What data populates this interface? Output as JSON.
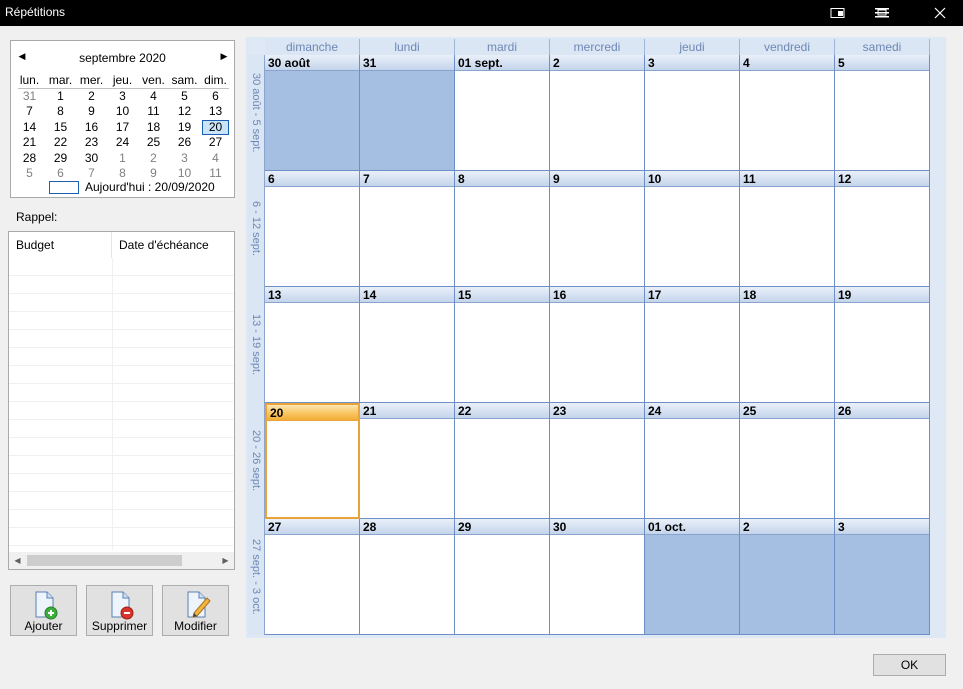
{
  "window": {
    "title": "Répétitions"
  },
  "minical": {
    "month_title": "septembre 2020",
    "weekdays": [
      "lun.",
      "mar.",
      "mer.",
      "jeu.",
      "ven.",
      "sam.",
      "dim."
    ],
    "days": [
      {
        "d": "31",
        "other": true
      },
      {
        "d": "1"
      },
      {
        "d": "2"
      },
      {
        "d": "3"
      },
      {
        "d": "4"
      },
      {
        "d": "5"
      },
      {
        "d": "6"
      },
      {
        "d": "7"
      },
      {
        "d": "8"
      },
      {
        "d": "9"
      },
      {
        "d": "10"
      },
      {
        "d": "11"
      },
      {
        "d": "12"
      },
      {
        "d": "13"
      },
      {
        "d": "14"
      },
      {
        "d": "15"
      },
      {
        "d": "16"
      },
      {
        "d": "17"
      },
      {
        "d": "18"
      },
      {
        "d": "19"
      },
      {
        "d": "20",
        "today": true
      },
      {
        "d": "21"
      },
      {
        "d": "22"
      },
      {
        "d": "23"
      },
      {
        "d": "24"
      },
      {
        "d": "25"
      },
      {
        "d": "26"
      },
      {
        "d": "27"
      },
      {
        "d": "28"
      },
      {
        "d": "29"
      },
      {
        "d": "30"
      },
      {
        "d": "1",
        "other": true
      },
      {
        "d": "2",
        "other": true
      },
      {
        "d": "3",
        "other": true
      },
      {
        "d": "4",
        "other": true
      },
      {
        "d": "5",
        "other": true
      },
      {
        "d": "6",
        "other": true
      },
      {
        "d": "7",
        "other": true
      },
      {
        "d": "8",
        "other": true
      },
      {
        "d": "9",
        "other": true
      },
      {
        "d": "10",
        "other": true
      },
      {
        "d": "11",
        "other": true
      }
    ],
    "today_label": "Aujourd'hui : 20/09/2020"
  },
  "reminder": {
    "label": "Rappel:",
    "columns": [
      "Budget",
      "Date d'échéance"
    ]
  },
  "actions": {
    "add": "Ajouter",
    "delete": "Supprimer",
    "edit": "Modifier"
  },
  "calendar": {
    "day_headers": [
      "dimanche",
      "lundi",
      "mardi",
      "mercredi",
      "jeudi",
      "vendredi",
      "samedi"
    ],
    "weeks": [
      {
        "label": "30 août - 5 sept.",
        "days": [
          {
            "d": "30 août",
            "other": true
          },
          {
            "d": "31",
            "other": true
          },
          {
            "d": "01 sept."
          },
          {
            "d": "2"
          },
          {
            "d": "3"
          },
          {
            "d": "4"
          },
          {
            "d": "5"
          }
        ]
      },
      {
        "label": "6 - 12 sept.",
        "days": [
          {
            "d": "6"
          },
          {
            "d": "7"
          },
          {
            "d": "8"
          },
          {
            "d": "9"
          },
          {
            "d": "10"
          },
          {
            "d": "11"
          },
          {
            "d": "12"
          }
        ]
      },
      {
        "label": "13 - 19 sept.",
        "days": [
          {
            "d": "13"
          },
          {
            "d": "14"
          },
          {
            "d": "15"
          },
          {
            "d": "16"
          },
          {
            "d": "17"
          },
          {
            "d": "18"
          },
          {
            "d": "19"
          }
        ]
      },
      {
        "label": "20 - 26 sept.",
        "days": [
          {
            "d": "20",
            "today": true
          },
          {
            "d": "21"
          },
          {
            "d": "22"
          },
          {
            "d": "23"
          },
          {
            "d": "24"
          },
          {
            "d": "25"
          },
          {
            "d": "26"
          }
        ]
      },
      {
        "label": "27 sept. - 3 oct.",
        "days": [
          {
            "d": "27"
          },
          {
            "d": "28"
          },
          {
            "d": "29"
          },
          {
            "d": "30"
          },
          {
            "d": "01 oct.",
            "other": true
          },
          {
            "d": "2",
            "other": true
          },
          {
            "d": "3",
            "other": true
          }
        ]
      }
    ]
  },
  "ok_label": "OK",
  "colors": {
    "accent": "#1a5fb4",
    "other_month": "#a5bfe2",
    "today": "#e8a33a"
  }
}
